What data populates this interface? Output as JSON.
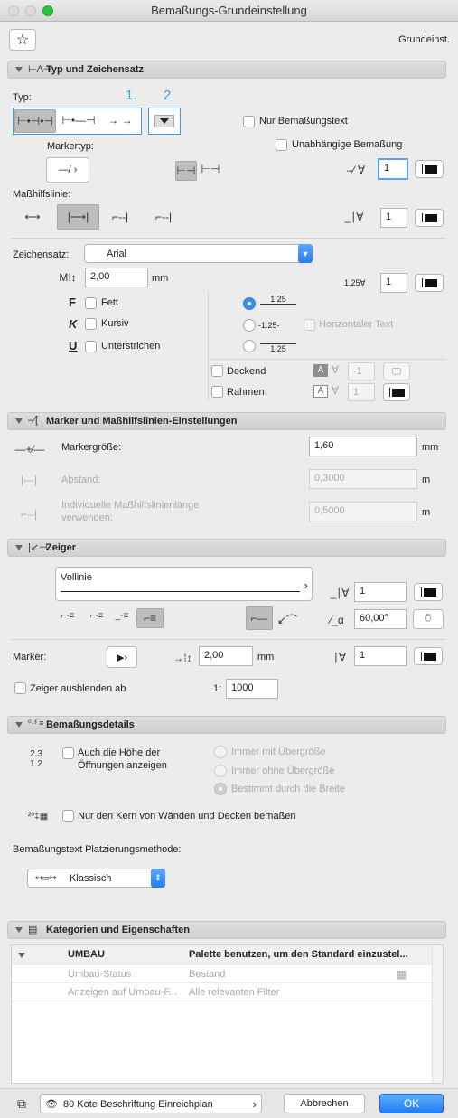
{
  "window": {
    "title": "Bemaßungs-Grundeinstellung",
    "favorite_label": "Grundeinst."
  },
  "colors": {
    "accent": "#3c8ef3",
    "ok_button": "#1f7cf4"
  },
  "type_section": {
    "title": "Typ und Zeichensatz",
    "typ_label": "Typ:",
    "callout1": "1.",
    "callout2": "2.",
    "nur_text": "Nur Bemaßungstext",
    "unabhaengig": "Unabhängige Bemaßung",
    "markertyp_label": "Markertyp:",
    "pen1": "1",
    "masshilfslinie_label": "Maßhilfslinie:",
    "pen2": "1",
    "zeichensatz_label": "Zeichensatz:",
    "font_value": "Arial",
    "size_value": "2,00",
    "size_unit": "mm",
    "pen3": "1",
    "fett": "Fett",
    "kursiv": "Kursiv",
    "unterstrichen": "Unterstrichen",
    "sample_value": "1.25",
    "sample_dashed": "-1.25-",
    "horizontal_text": "Horizontaler Text",
    "deckend": "Deckend",
    "deckend_value": "-1",
    "rahmen": "Rahmen",
    "rahmen_value": "1"
  },
  "marker_section": {
    "title": "Marker und Maßhilfslinien-Einstellungen",
    "markergroesse": "Markergröße:",
    "markergroesse_value": "1,60",
    "unit_mm": "mm",
    "abstand": "Abstand:",
    "abstand_value": "0,3000",
    "unit_m": "m",
    "individuell": "Individuelle Maßhilfslinienlänge verwenden:",
    "individuell_value": "0,5000"
  },
  "zeiger_section": {
    "title": "Zeiger",
    "line_type": "Vollinie",
    "pen": "1",
    "angle": "60,00°",
    "marker_label": "Marker:",
    "marker_size": "2,00",
    "unit_mm": "mm",
    "marker_pen": "1",
    "hide_label": "Zeiger ausblenden ab",
    "scale_prefix": "1:",
    "scale_value": "1000"
  },
  "details_section": {
    "title": "Bemaßungsdetails",
    "hoehe_label": "Auch die Höhe der Öffnungen anzeigen",
    "immer_mit": "Immer mit Übergröße",
    "immer_ohne": "Immer ohne Übergröße",
    "bestimmt": "Bestimmt durch die Breite",
    "kern": "Nur den Kern von Wänden und Decken bemaßen",
    "placement_label": "Bemaßungstext Platzierungsmethode:",
    "placement_value": "Klassisch"
  },
  "categories_section": {
    "title": "Kategorien und Eigenschaften",
    "group_name": "UMBAU",
    "group_value": "Palette benutzen, um den Standard einzustel...",
    "rows": [
      {
        "name": "Umbau-Status",
        "value": "Bestand"
      },
      {
        "name": "Anzeigen auf Umbau-F...",
        "value": "Alle relevanten Filter"
      }
    ]
  },
  "footer": {
    "layer": "80 Kote Beschriftung Einreichplan",
    "cancel": "Abbrechen",
    "ok": "OK"
  }
}
